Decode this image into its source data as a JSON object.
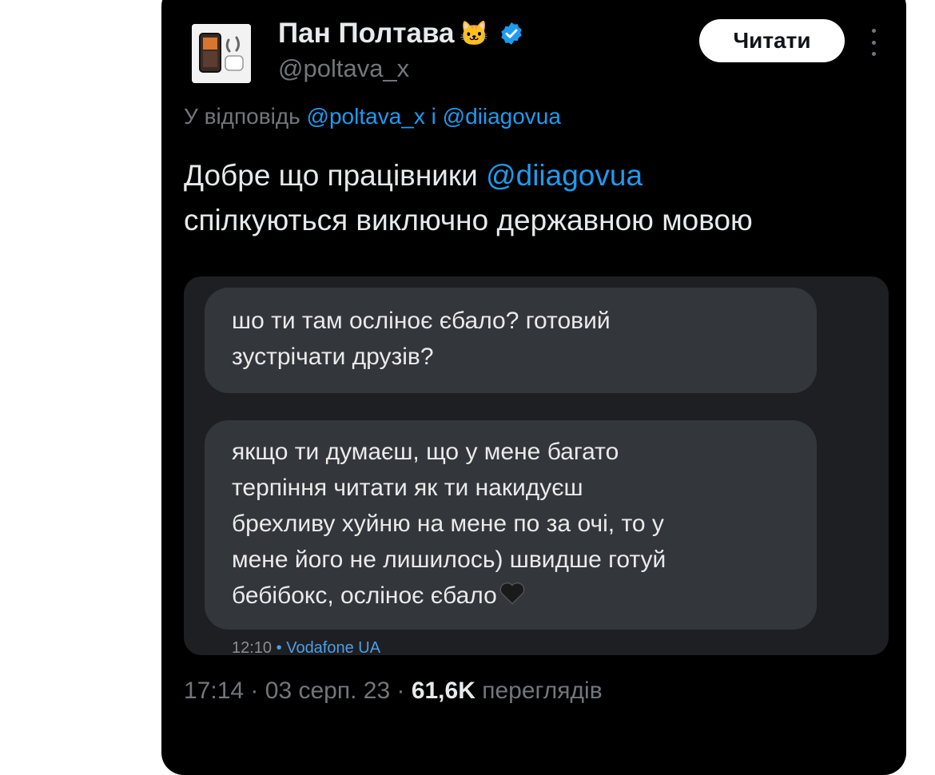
{
  "author": {
    "display_name": "Пан Полтава",
    "name_emoji": "🐱",
    "handle": "@poltava_x",
    "verified": true,
    "avatar": "phone-and-airpods-avatar"
  },
  "follow_button": {
    "label": "Читати"
  },
  "more_menu": {
    "icon": "more-vertical-icon"
  },
  "reply": {
    "prefix": "У відповідь",
    "mention_1": "@poltava_x",
    "conjunction": "і",
    "mention_2": "@diiagovua"
  },
  "tweet": {
    "text_part1": "Добре що працівники",
    "mention": "@diiagovua",
    "text_part2": "спілкуються виключно державною мовою"
  },
  "media": {
    "messages": [
      {
        "lines": [
          "шо ти там осліноє єбало? готовий",
          "зустрічати друзів?"
        ]
      },
      {
        "lines": [
          "якщо ти думаєш, що у мене багато",
          "терпіння читати як ти накидуєш",
          "брехливу хуйню на мене по за очі, то у",
          "мене його не лишилось) швидше готуй",
          "бебібокс, осліноє єбало"
        ],
        "trailing_emoji": "black-heart-icon"
      }
    ],
    "sms_time": "12:10",
    "sms_separator": "•",
    "sms_carrier": "Vodafone UA"
  },
  "meta": {
    "time": "17:14",
    "date": "03 серп. 23",
    "separator": "·",
    "views_count": "61,6K",
    "views_label": "переглядів"
  },
  "colors": {
    "background": "#000000",
    "accent": "#1d9bf0",
    "secondary_text": "#71767b",
    "primary_text": "#e7e9ea",
    "bubble": "#33363b"
  }
}
